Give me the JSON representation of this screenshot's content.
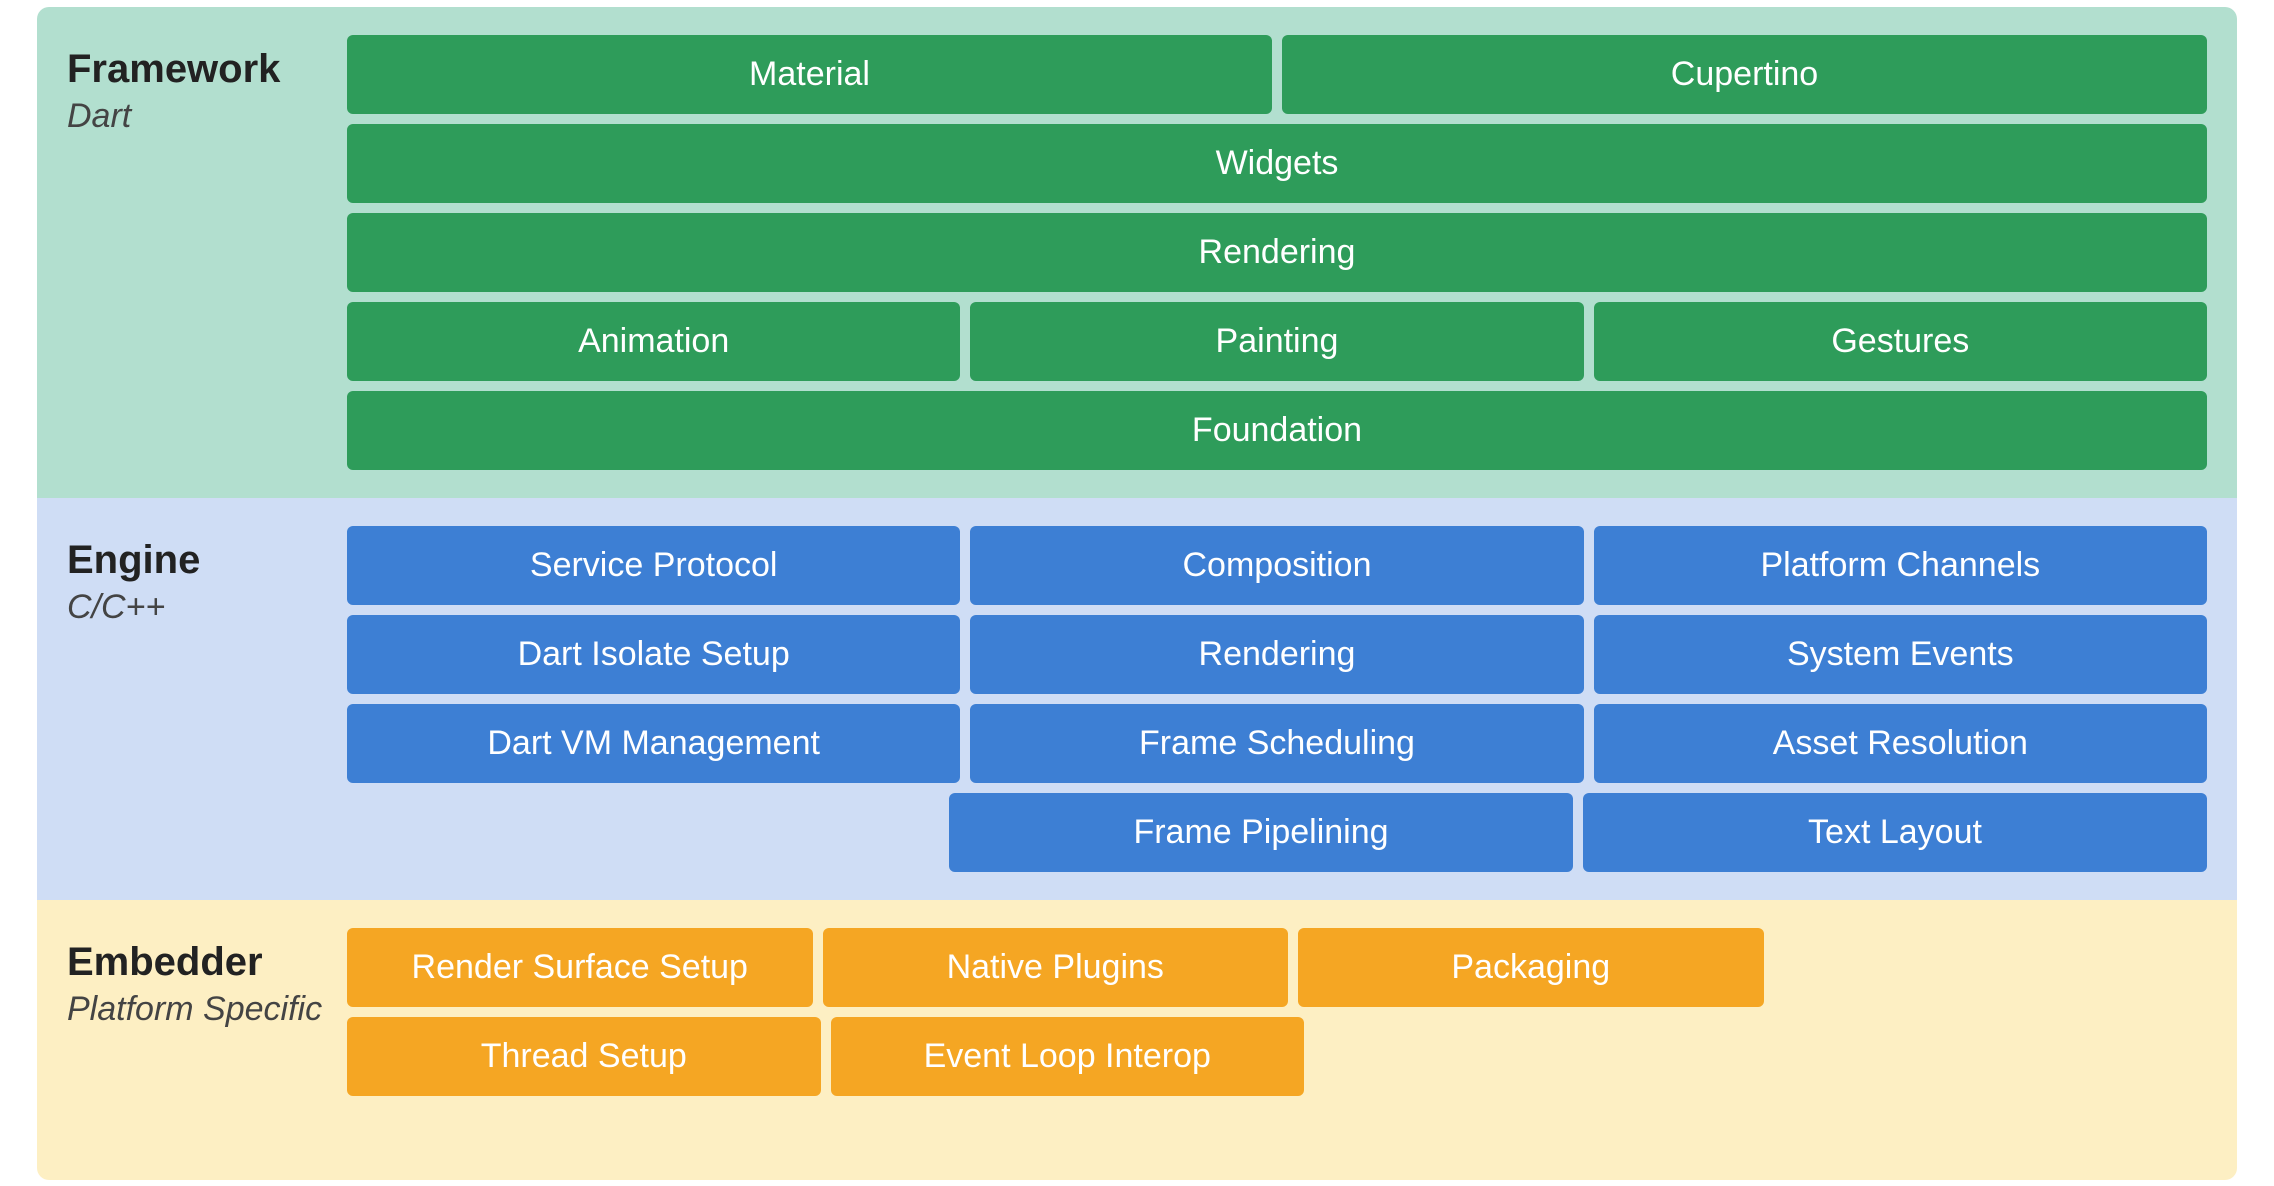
{
  "framework": {
    "title": "Framework",
    "subtitle": "Dart",
    "rows": [
      [
        {
          "label": "Material",
          "flex": 2
        },
        {
          "label": "Cupertino",
          "flex": 2
        }
      ],
      [
        {
          "label": "Widgets",
          "flex": 4
        }
      ],
      [
        {
          "label": "Rendering",
          "flex": 4
        }
      ],
      [
        {
          "label": "Animation",
          "flex": 1
        },
        {
          "label": "Painting",
          "flex": 1
        },
        {
          "label": "Gestures",
          "flex": 1
        }
      ],
      [
        {
          "label": "Foundation",
          "flex": 4
        }
      ]
    ]
  },
  "engine": {
    "title": "Engine",
    "subtitle": "C/C++",
    "rows": [
      [
        {
          "label": "Service Protocol",
          "flex": 1
        },
        {
          "label": "Composition",
          "flex": 1
        },
        {
          "label": "Platform Channels",
          "flex": 1
        }
      ],
      [
        {
          "label": "Dart Isolate Setup",
          "flex": 1
        },
        {
          "label": "Rendering",
          "flex": 1
        },
        {
          "label": "System Events",
          "flex": 1
        }
      ],
      [
        {
          "label": "Dart VM Management",
          "flex": 1
        },
        {
          "label": "Frame Scheduling",
          "flex": 1
        },
        {
          "label": "Asset Resolution",
          "flex": 1
        }
      ],
      [
        {
          "label": "",
          "flex": 1,
          "empty": true
        },
        {
          "label": "Frame Pipelining",
          "flex": 1
        },
        {
          "label": "Text Layout",
          "flex": 1
        }
      ]
    ]
  },
  "embedder": {
    "title": "Embedder",
    "subtitle": "Platform Specific",
    "rows": [
      [
        {
          "label": "Render Surface Setup",
          "flex": 1
        },
        {
          "label": "Native Plugins",
          "flex": 1
        },
        {
          "label": "Packaging",
          "flex": 1
        },
        {
          "label": "",
          "flex": 0.1,
          "empty": true
        }
      ],
      [
        {
          "label": "Thread Setup",
          "flex": 1
        },
        {
          "label": "Event Loop Interop",
          "flex": 1
        },
        {
          "label": "",
          "flex": 1.1,
          "empty": true
        }
      ]
    ]
  }
}
